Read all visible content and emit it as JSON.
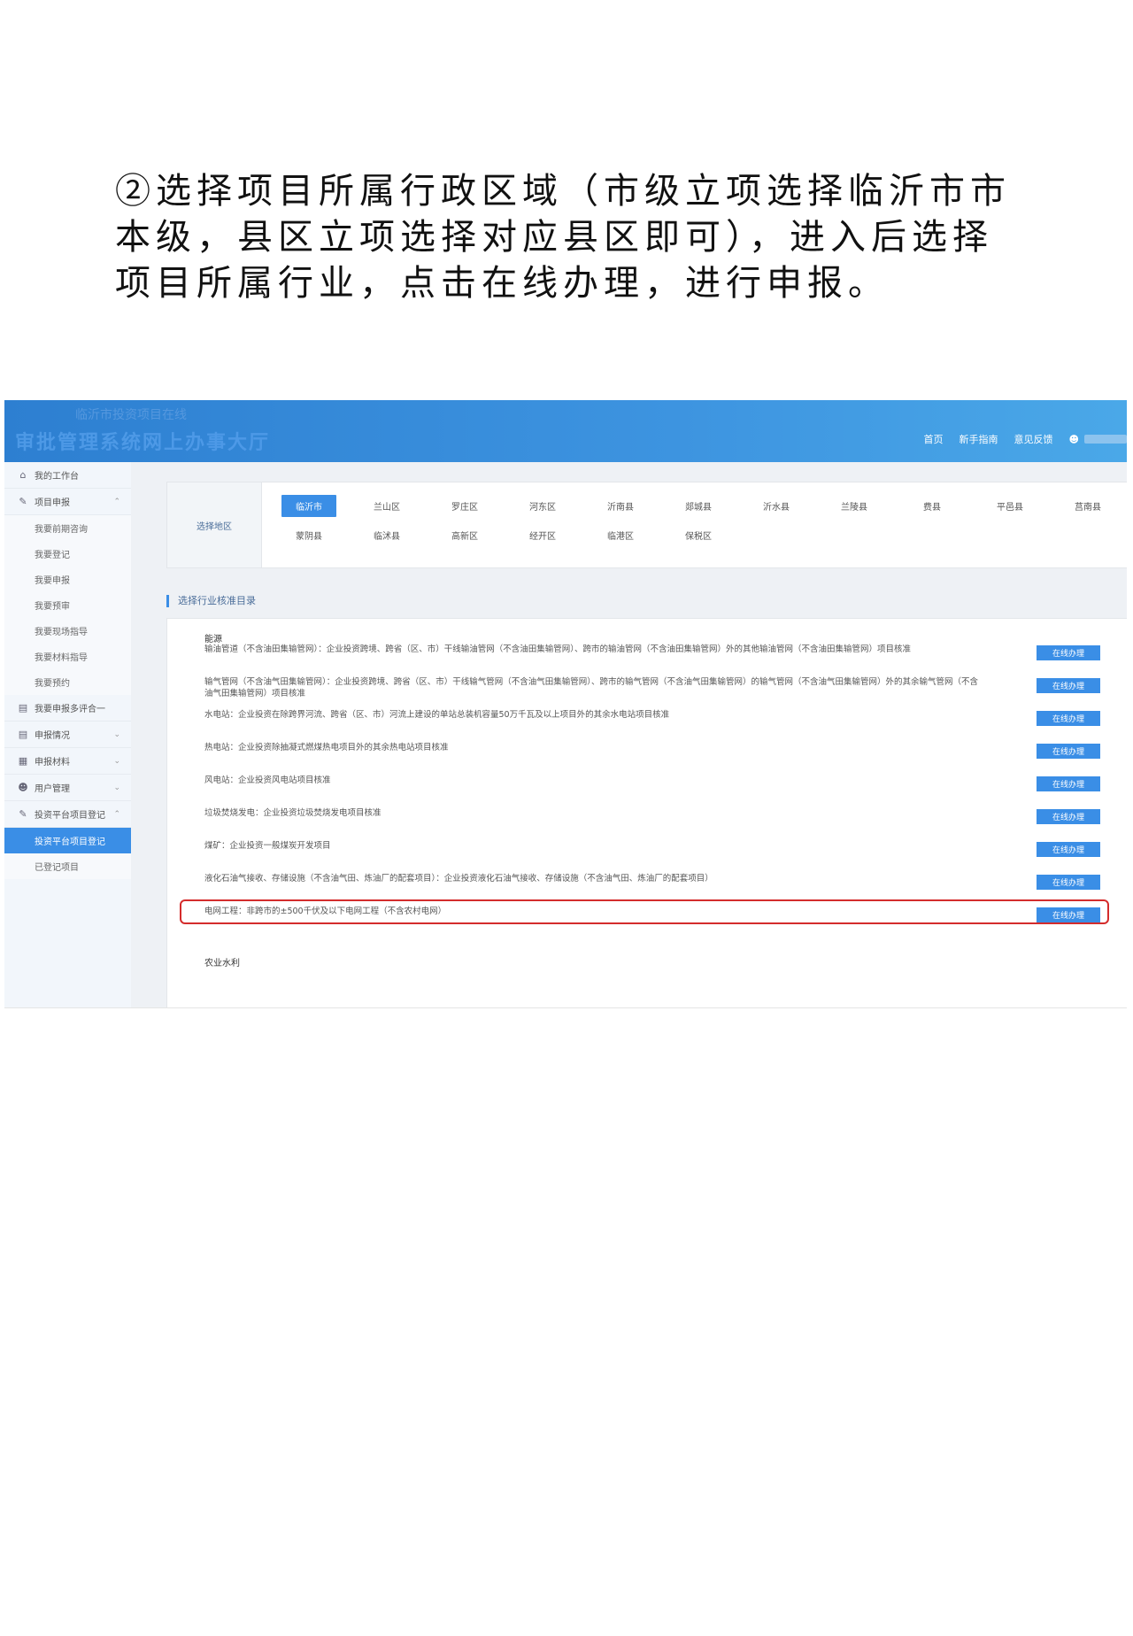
{
  "instruction": "②选择项目所属行政区域（市级立项选择临沂市市本级，县区立项选择对应县区即可），进入后选择项目所属行业，点击在线办理，进行申报。",
  "header": {
    "logo_sub": "临沂市投资项目在线",
    "logo_main": "审批管理系统网上办事大厅",
    "nav": [
      "首页",
      "新手指南",
      "意见反馈"
    ],
    "user_icon": "user-icon"
  },
  "sidebar": {
    "items": [
      {
        "label": "我的工作台",
        "icon": "home-icon"
      },
      {
        "label": "项目申报",
        "icon": "edit-doc-icon",
        "expanded": true,
        "children": [
          "我要前期咨询",
          "我要登记",
          "我要申报",
          "我要预审",
          "我要现场指导",
          "我要材料指导",
          "我要预约"
        ]
      },
      {
        "label": "我要申报多评合一",
        "icon": "folder-icon"
      },
      {
        "label": "申报情况",
        "icon": "folder-icon"
      },
      {
        "label": "申报材料",
        "icon": "stack-icon"
      },
      {
        "label": "用户管理",
        "icon": "user-icon"
      },
      {
        "label": "投资平台项目登记",
        "icon": "edit-doc-icon",
        "expanded": true,
        "children": [
          "投资平台项目登记",
          "已登记项目"
        ],
        "active_child": "投资平台项目登记"
      }
    ]
  },
  "region": {
    "label": "选择地区",
    "items": [
      "临沂市",
      "兰山区",
      "罗庄区",
      "河东区",
      "沂南县",
      "郯城县",
      "沂水县",
      "兰陵县",
      "费县",
      "平邑县",
      "莒南县",
      "蒙阴县",
      "临沭县",
      "高新区",
      "经开区",
      "临港区",
      "保税区"
    ],
    "selected": "临沂市"
  },
  "catalog": {
    "title": "选择行业核准目录",
    "category": "能源",
    "button_label": "在线办理",
    "rows": [
      "输油管道（不含油田集输管网）：企业投资跨境、跨省（区、市）干线输油管网（不含油田集输管网）、跨市的输油管网（不含油田集输管网）外的其他输油管网（不含油田集输管网）项目核准",
      "输气管网（不含油气田集输管网）：企业投资跨境、跨省（区、市）干线输气管网（不含油气田集输管网）、跨市的输气管网（不含油气田集输管网）的输气管网（不含油气田集输管网）外的其余输气管网（不含油气田集输管网）项目核准",
      "水电站：企业投资在除跨界河流、跨省（区、市）河流上建设的单站总装机容量50万千瓦及以上项目外的其余水电站项目核准",
      "热电站：企业投资除抽凝式燃煤热电项目外的其余热电站项目核准",
      "风电站：企业投资风电站项目核准",
      "垃圾焚烧发电：企业投资垃圾焚烧发电项目核准",
      "煤矿：企业投资一般煤炭开发项目",
      "液化石油气接收、存储设施（不含油气田、炼油厂的配套项目）：企业投资液化石油气接收、存储设施（不含油气田、炼油厂的配套项目）",
      "电网工程：非跨市的±500千伏及以下电网工程（不含农村电网）"
    ],
    "highlighted_row": 8,
    "next_category": "农业水利",
    "highlight_color": "#d42c2c"
  }
}
